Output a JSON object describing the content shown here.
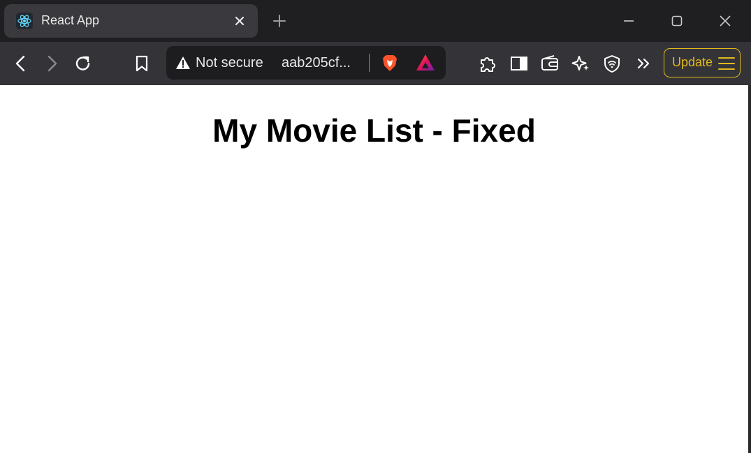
{
  "tab": {
    "title": "React App"
  },
  "omnibox": {
    "security_label": "Not secure",
    "url": "aab205cf..."
  },
  "toolbar": {
    "update_label": "Update"
  },
  "page": {
    "heading": "My Movie List - Fixed"
  },
  "colors": {
    "accent": "#e2b91c",
    "brave_orange": "#fb542b",
    "react_cyan": "#61dafb"
  }
}
